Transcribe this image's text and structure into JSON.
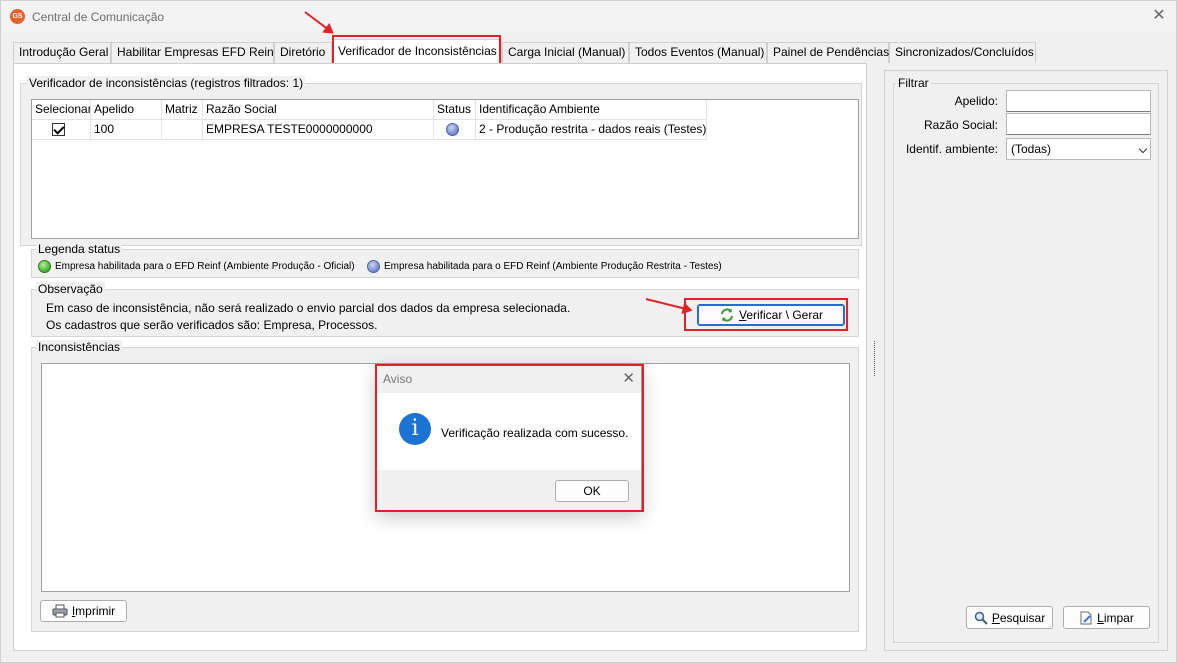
{
  "window": {
    "title": "Central de Comunicação",
    "app_icon_text": "GS",
    "close_glyph": "✕"
  },
  "tabs": [
    {
      "label": "Introdução Geral"
    },
    {
      "label": "Habilitar Empresas EFD Reinf"
    },
    {
      "label": "Diretório"
    },
    {
      "label": "Verificador de Inconsistências",
      "active": true
    },
    {
      "label": "Carga Inicial (Manual)"
    },
    {
      "label": "Todos Eventos (Manual)"
    },
    {
      "label": "Painel de Pendências"
    },
    {
      "label": "Sincronizados/Concluídos"
    }
  ],
  "verifier": {
    "group_title": "Verificador de inconsistências (registros filtrados: 1)",
    "columns": [
      "Selecionar",
      "Apelido",
      "Matriz",
      "Razão Social",
      "Status",
      "Identificação Ambiente"
    ],
    "rows": [
      {
        "selected": true,
        "apelido": "100",
        "matriz": "",
        "razao_social": "EMPRESA TESTE0000000000",
        "status": "blue",
        "ambiente": "2 - Produção restrita - dados reais (Testes)"
      }
    ]
  },
  "legend": {
    "title": "Legenda status",
    "items": [
      {
        "color": "green",
        "label": "Empresa habilitada para o EFD Reinf (Ambiente Produção - Oficial)"
      },
      {
        "color": "blue",
        "label": "Empresa habilitada para o EFD Reinf (Ambiente Produção Restrita - Testes)"
      }
    ]
  },
  "observacao": {
    "title": "Observação",
    "line1": "Em caso de inconsistência, não será realizado o envio parcial dos dados da empresa selecionada.",
    "line2": "Os cadastros que serão verificados são: Empresa, Processos.",
    "button_label_first": "V",
    "button_label_rest": "erificar \\ Gerar",
    "button_icon": "refresh-icon"
  },
  "inconsistencias": {
    "title": "Inconsistências",
    "print_label_first": "I",
    "print_label_rest": "mprimir",
    "print_icon": "printer-icon"
  },
  "filter": {
    "title": "Filtrar",
    "apelido_label": "Apelido:",
    "apelido_value": "",
    "razao_label": "Razão Social:",
    "razao_value": "",
    "ambiente_label": "Identif. ambiente:",
    "ambiente_value": "(Todas)",
    "search_label_first": "P",
    "search_label_rest": "esquisar",
    "clear_label_first": "L",
    "clear_label_rest": "impar"
  },
  "dialog": {
    "title": "Aviso",
    "message": "Verificação realizada com sucesso.",
    "ok_label": "OK",
    "icon": "info-icon",
    "close_glyph": "✕"
  },
  "colors": {
    "highlight": "#e32228",
    "status_blue": "#6d86c9",
    "status_green": "#3fae2d",
    "info_blue": "#1b73d4"
  }
}
